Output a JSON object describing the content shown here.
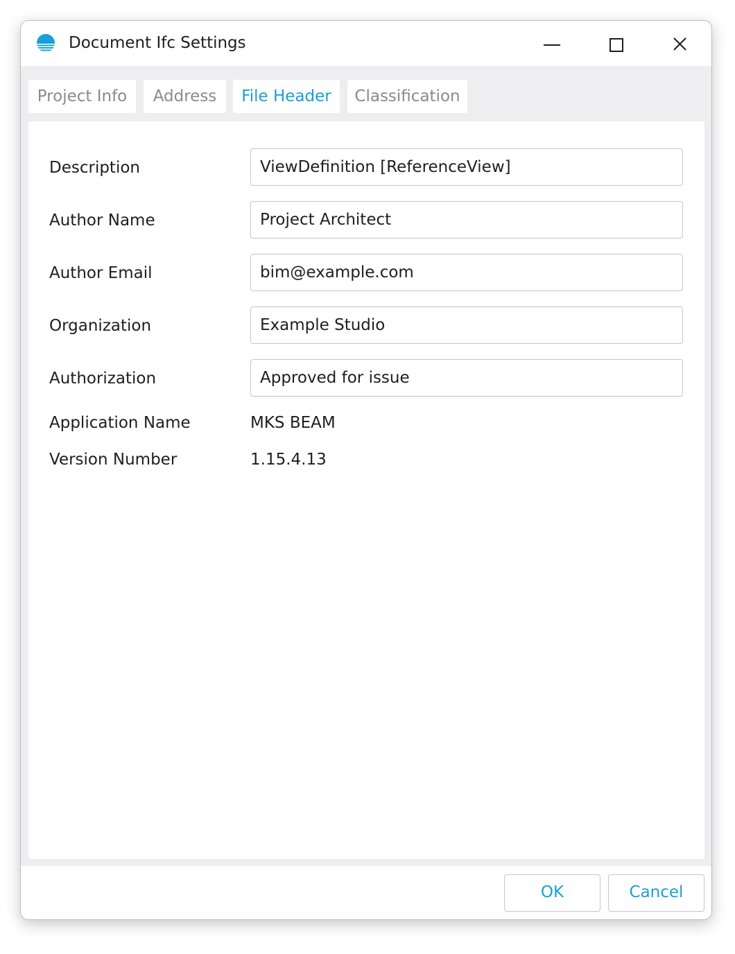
{
  "window": {
    "title": "Document Ifc Settings",
    "icon": "app-logo-icon",
    "controls": {
      "minimize": "minimize-icon",
      "maximize": "maximize-icon",
      "close": "close-icon"
    }
  },
  "tabs": [
    {
      "label": "Project Info",
      "active": false
    },
    {
      "label": "Address",
      "active": false
    },
    {
      "label": "File Header",
      "active": true
    },
    {
      "label": "Classification",
      "active": false
    }
  ],
  "form": {
    "description": {
      "label": "Description",
      "value": "ViewDefinition [ReferenceView]"
    },
    "author_name": {
      "label": "Author Name",
      "value": "Project Architect"
    },
    "author_email": {
      "label": "Author Email",
      "value": "bim@example.com"
    },
    "organization": {
      "label": "Organization",
      "value": "Example Studio"
    },
    "authorization": {
      "label": "Authorization",
      "value": "Approved for issue"
    },
    "application_name": {
      "label": "Application Name",
      "value": "MKS BEAM"
    },
    "version_number": {
      "label": "Version Number",
      "value": "1.15.4.13"
    }
  },
  "footer": {
    "ok_label": "OK",
    "cancel_label": "Cancel"
  },
  "colors": {
    "accent": "#1a9fd6",
    "inactive_tab_text": "#8a8a8a",
    "background": "#eeeef0"
  }
}
